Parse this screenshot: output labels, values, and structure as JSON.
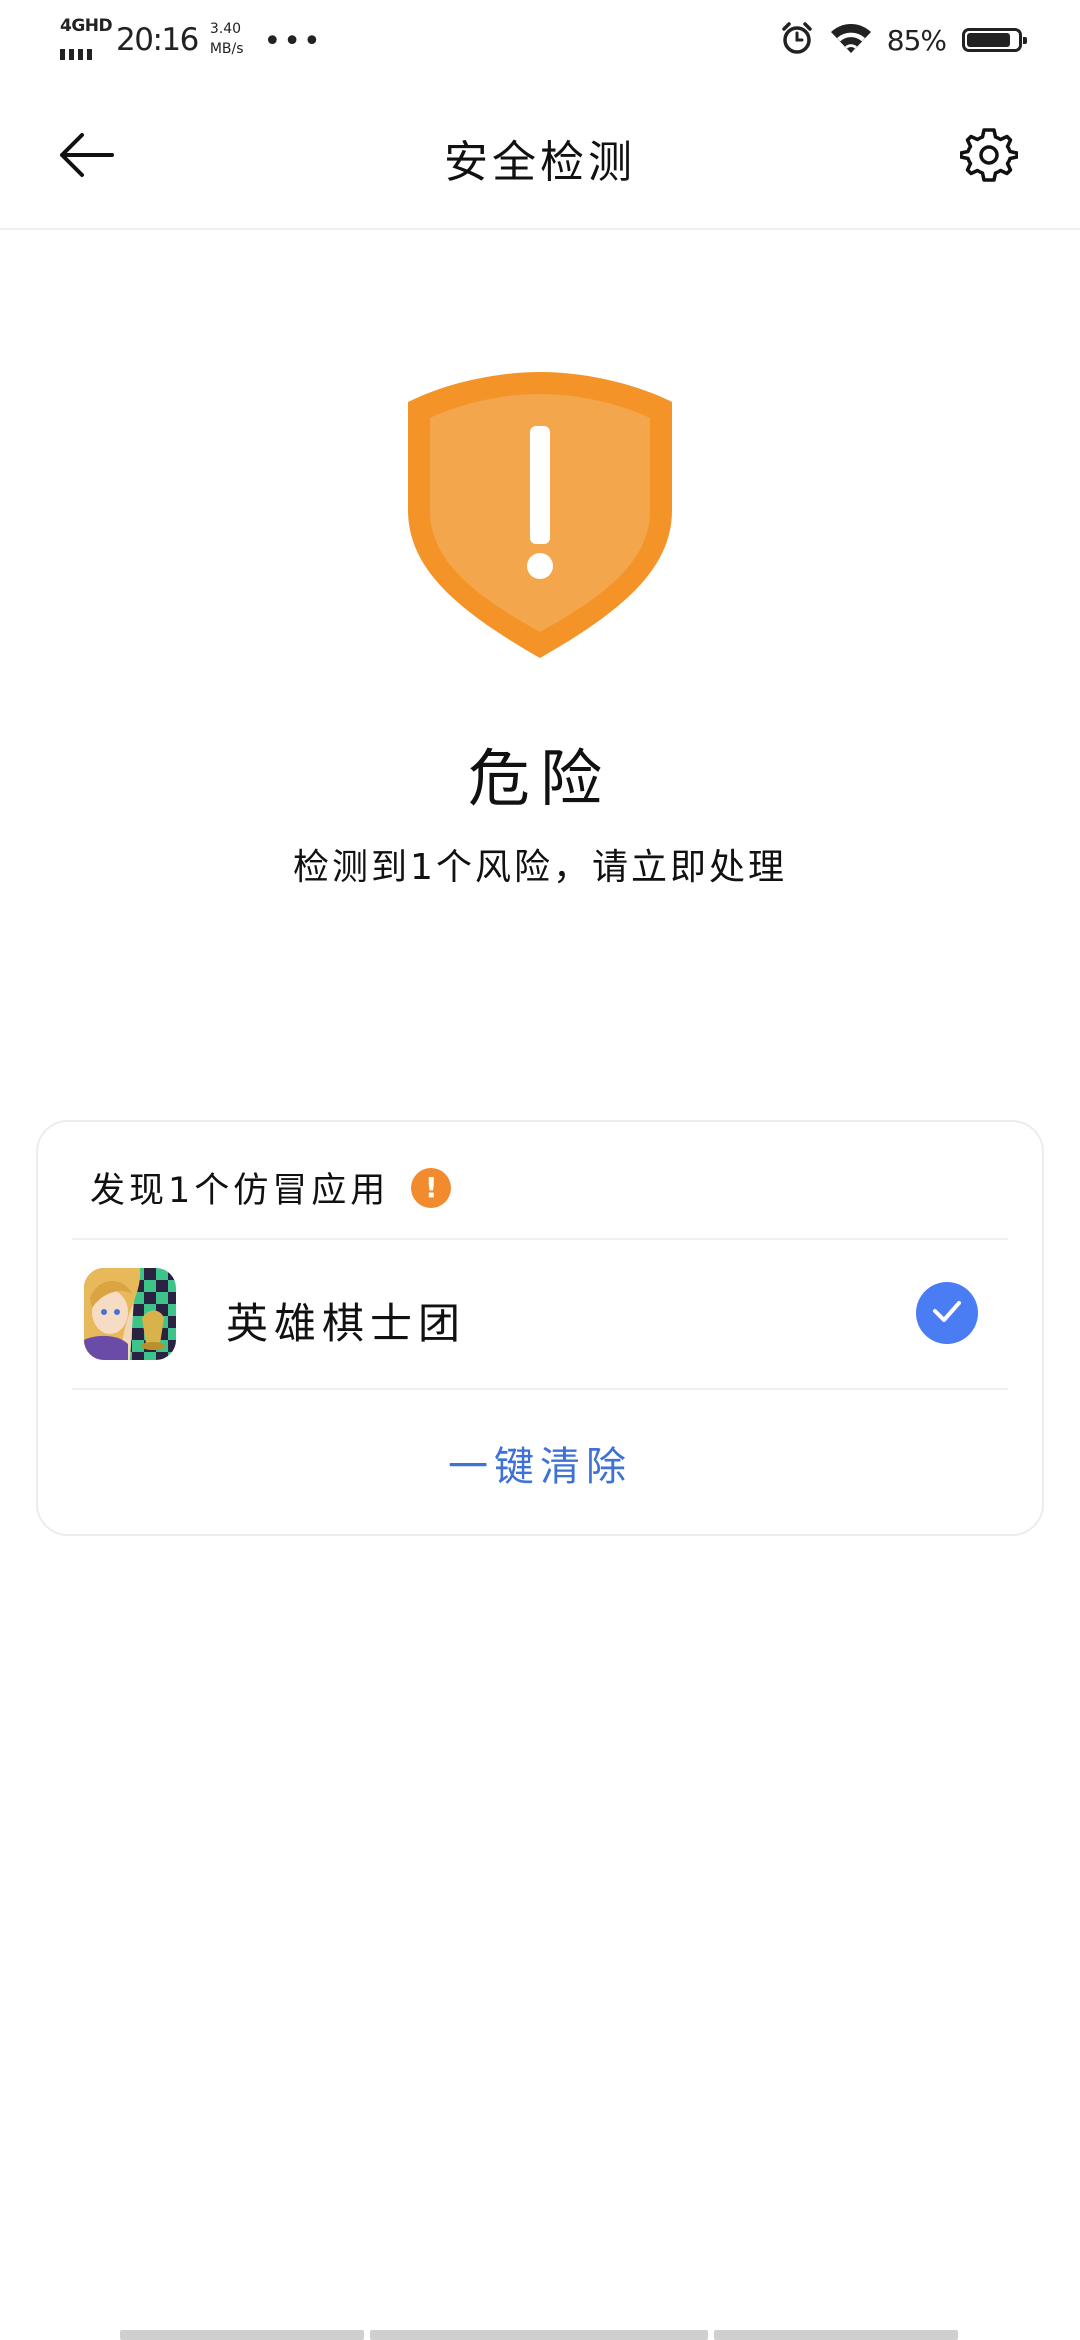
{
  "status_bar": {
    "network_type": "4GHD",
    "time": "20:16",
    "net_speed_value": "3.40",
    "net_speed_unit": "MB/s",
    "more_dots": "•••",
    "battery_percent": "85%",
    "battery_level": 0.85,
    "icons": [
      "signal-icon",
      "alarm-icon",
      "wifi-icon",
      "battery-icon"
    ]
  },
  "header": {
    "title": "安全检测",
    "back_icon": "arrow-left-icon",
    "settings_icon": "gear-icon"
  },
  "status": {
    "icon": "warning-shield-icon",
    "title": "危险",
    "subtitle": "检测到1个风险，请立即处理",
    "color": "#f28a2e"
  },
  "risk_card": {
    "header": "发现1个仿冒应用",
    "badge_icon": "exclamation-icon",
    "badge_symbol": "!",
    "apps": [
      {
        "name": "英雄棋士团",
        "icon": "app-icon",
        "selected": true
      }
    ],
    "action_label": "一键清除",
    "action_color": "#3f72d6",
    "check_color": "#4a7cf3"
  }
}
